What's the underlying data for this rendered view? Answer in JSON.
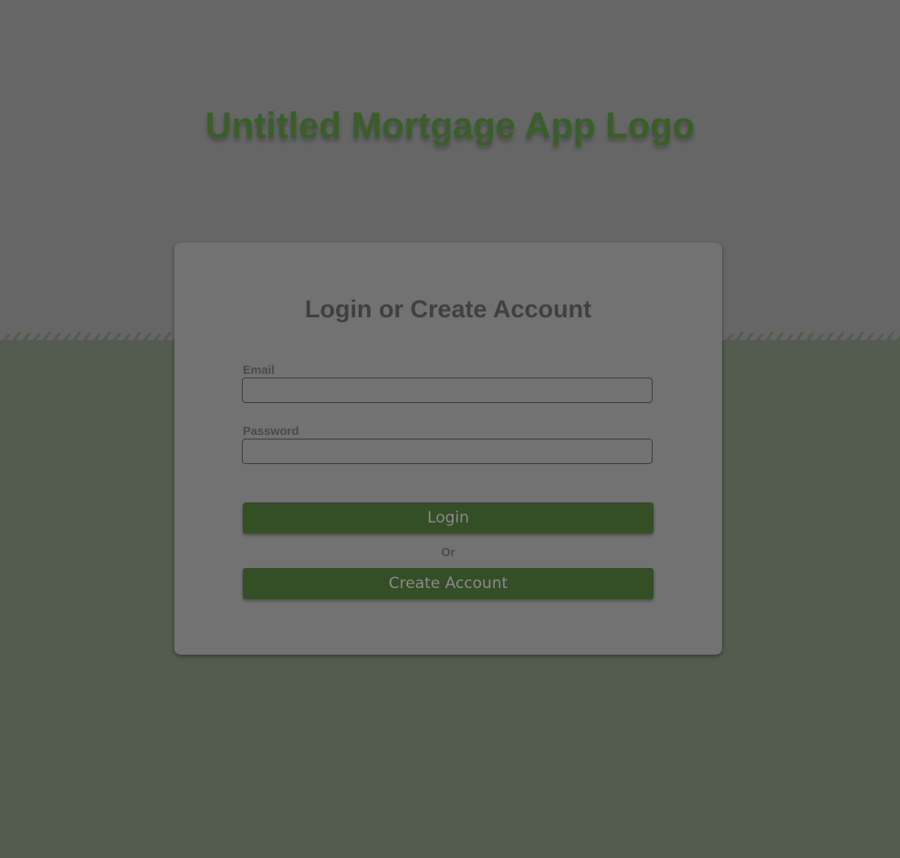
{
  "header": {
    "logo_text": "Untitled Mortgage App Logo"
  },
  "login_card": {
    "title": "Login or Create Account",
    "email": {
      "label": "Email",
      "value": "",
      "placeholder": ""
    },
    "password": {
      "label": "Password",
      "value": "",
      "placeholder": ""
    },
    "login_button_label": "Login",
    "separator_text": "Or",
    "create_account_button_label": "Create Account"
  },
  "colors": {
    "page_background": "#666666",
    "lower_background": "#535c4f",
    "brand_green": "#3a5e2a",
    "button_green": "#344e25",
    "card_background": "#727272"
  }
}
